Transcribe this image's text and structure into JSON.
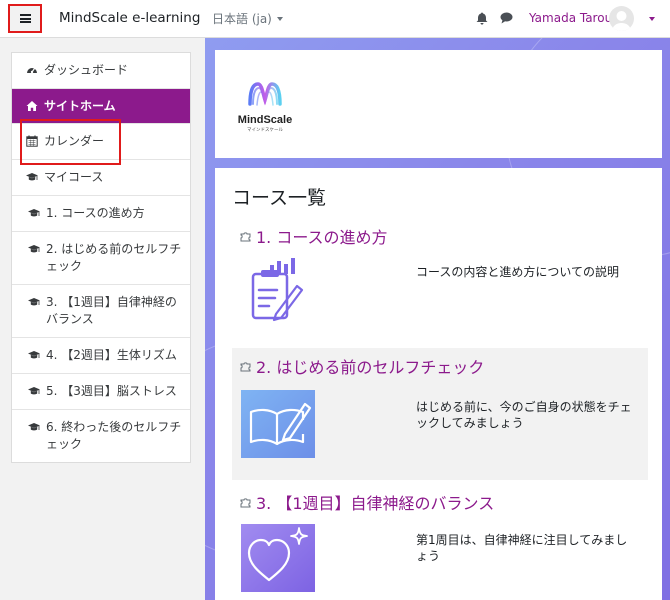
{
  "navbar": {
    "brand": "MindScale e-learning",
    "language": "日本語 (ja)",
    "user_name": "Yamada Tarou",
    "icons": [
      "menu-icon",
      "bell-icon",
      "chat-icon",
      "avatar-icon",
      "chevron-down-icon"
    ]
  },
  "drawer": {
    "items": [
      {
        "label": "ダッシュボード",
        "icon": "dashboard-icon"
      },
      {
        "label": "サイトホーム",
        "icon": "home-icon",
        "active": true
      },
      {
        "label": "カレンダー",
        "icon": "calendar-icon"
      },
      {
        "label": "マイコース",
        "icon": "graduation-cap-icon"
      },
      {
        "label": "1. コースの進め方",
        "icon": "graduation-cap-icon"
      },
      {
        "label": "2. はじめる前のセルフチェック",
        "icon": "graduation-cap-icon"
      },
      {
        "label": "3. 【1週目】自律神経のバランス",
        "icon": "graduation-cap-icon"
      },
      {
        "label": "4. 【2週目】生体リズム",
        "icon": "graduation-cap-icon"
      },
      {
        "label": "5. 【3週目】脳ストレス",
        "icon": "graduation-cap-icon"
      },
      {
        "label": "6. 終わった後のセルフチェック",
        "icon": "graduation-cap-icon"
      }
    ]
  },
  "main": {
    "logo": {
      "name": "MindScale",
      "tagline": "マインドスケール"
    },
    "section_title": "コース一覧",
    "courses": [
      {
        "title": "1. コースの進め方",
        "description": "コースの内容と進め方についての説明",
        "icon": "clipboard-chart-icon"
      },
      {
        "title": "2. はじめる前のセルフチェック",
        "description": "はじめる前に、今のご自身の状態をチェックしてみましょう",
        "icon": "book-pen-icon"
      },
      {
        "title": "3. 【1週目】自律神経のバランス",
        "description": "第1周目は、自律神経に注目してみましょう",
        "icon": "heart-sparkle-icon"
      }
    ]
  },
  "colors": {
    "accent": "#8c1a8c",
    "highlight_box": "#e01b1b",
    "background_purple": "#8a86ea"
  }
}
